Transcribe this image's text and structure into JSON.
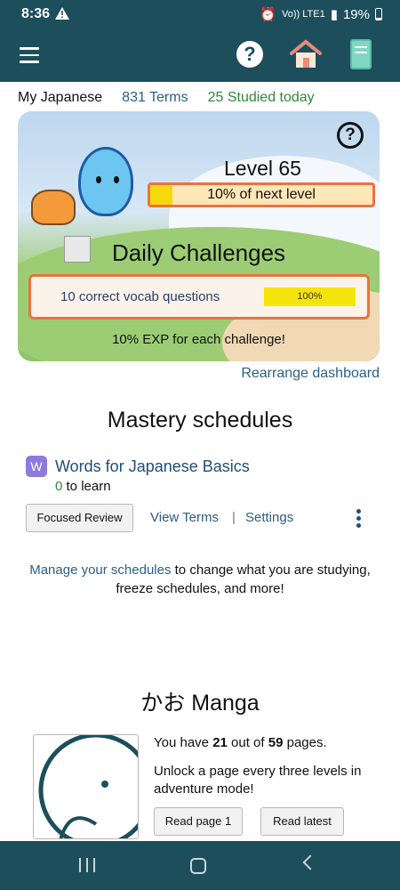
{
  "status_bar": {
    "time": "8:36",
    "network": "Vo)) LTE1",
    "battery": "19%"
  },
  "app_bar": {
    "help_icon": "?"
  },
  "top_info": {
    "name": "My Japanese",
    "terms": "831 Terms",
    "studied": "25 Studied today"
  },
  "dashboard": {
    "help_icon": "?",
    "level": "Level 65",
    "level_progress_text": "10% of next level",
    "level_progress": 0.1,
    "daily_title": "Daily Challenges",
    "challenge_label": "10 correct vocab questions",
    "challenge_progress_text": "100%",
    "exp_text": "10% EXP for each challenge!"
  },
  "rearrange": "Rearrange dashboard",
  "mastery": {
    "title": "Mastery schedules",
    "badge": "W",
    "schedule_name": "Words for Japanese Basics",
    "to_learn_count": "0",
    "to_learn_label": " to learn",
    "focused_review": "Focused Review",
    "view_terms": "View Terms",
    "separator": "|",
    "settings": "Settings",
    "manage_link": "Manage your schedules",
    "manage_rest": " to change what you are studying, freeze schedules, and more!"
  },
  "manga": {
    "title": "かお Manga",
    "pages_prefix": "You have ",
    "pages_have": "21",
    "pages_mid": " out of ",
    "pages_total": "59",
    "pages_suffix": " pages.",
    "unlock": "Unlock a page every three levels in adventure mode!",
    "read_page": "Read page 1",
    "read_latest": "Read latest"
  },
  "colors": {
    "header": "#1d4e5c",
    "accent_orange": "#e9733b",
    "progress_yellow": "#f5d90c",
    "link_blue": "#2b5f86"
  }
}
